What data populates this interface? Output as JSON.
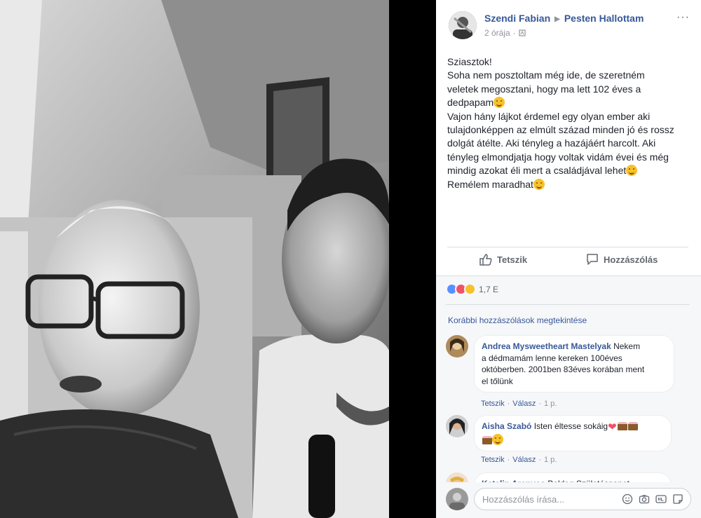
{
  "post": {
    "author": "Szendi Fabian",
    "group": "Pesten Hallottam",
    "time": "2 órája",
    "meta_dot": "·",
    "more_label": "···",
    "text_lines": [
      "Sziasztok!",
      "Soha nem posztoltam még ide, de szeretném",
      "veletek megosztani, hogy ma lett 102 éves a",
      "dedpapam",
      "Vajon hány lájkot érdemel egy olyan ember aki",
      "tulajdonképpen az elmúlt század minden jó és rossz",
      "dolgát átélte. Aki tényleg a hazájáért harcolt. Aki",
      "tényleg elmondjatja hogy voltak vidám évei és még",
      "mindig azokat éli mert a családjával lehet",
      "Remélem maradhat"
    ]
  },
  "actions": {
    "like": "Tetszik",
    "comment": "Hozzászólás"
  },
  "reactions": {
    "count": "1,7 E"
  },
  "previous_comments": "Korábbi hozzászólások megtekintése",
  "comments": [
    {
      "author": "Andrea Mysweetheart Mastelyak",
      "lines": [
        "Nekem",
        "a dédmamám lenne kereken 100éves",
        "októberben. 2001ben 83éves korában ment",
        "el tőlünk"
      ],
      "like": "Tetszik",
      "reply": "Válasz",
      "time": "1 p."
    },
    {
      "author": "Aisha Szabó",
      "text": "Isten éltesse sokáig",
      "like": "Tetszik",
      "reply": "Válasz",
      "time": "1 p."
    },
    {
      "author": "Katalin Aranyos",
      "text": "Boldog Születésnapot"
    }
  ],
  "composer": {
    "placeholder": "Hozzászólás írása..."
  },
  "colors": {
    "link": "#365899",
    "panel_bg": "#f6f7f9",
    "text": "#1d2129"
  }
}
